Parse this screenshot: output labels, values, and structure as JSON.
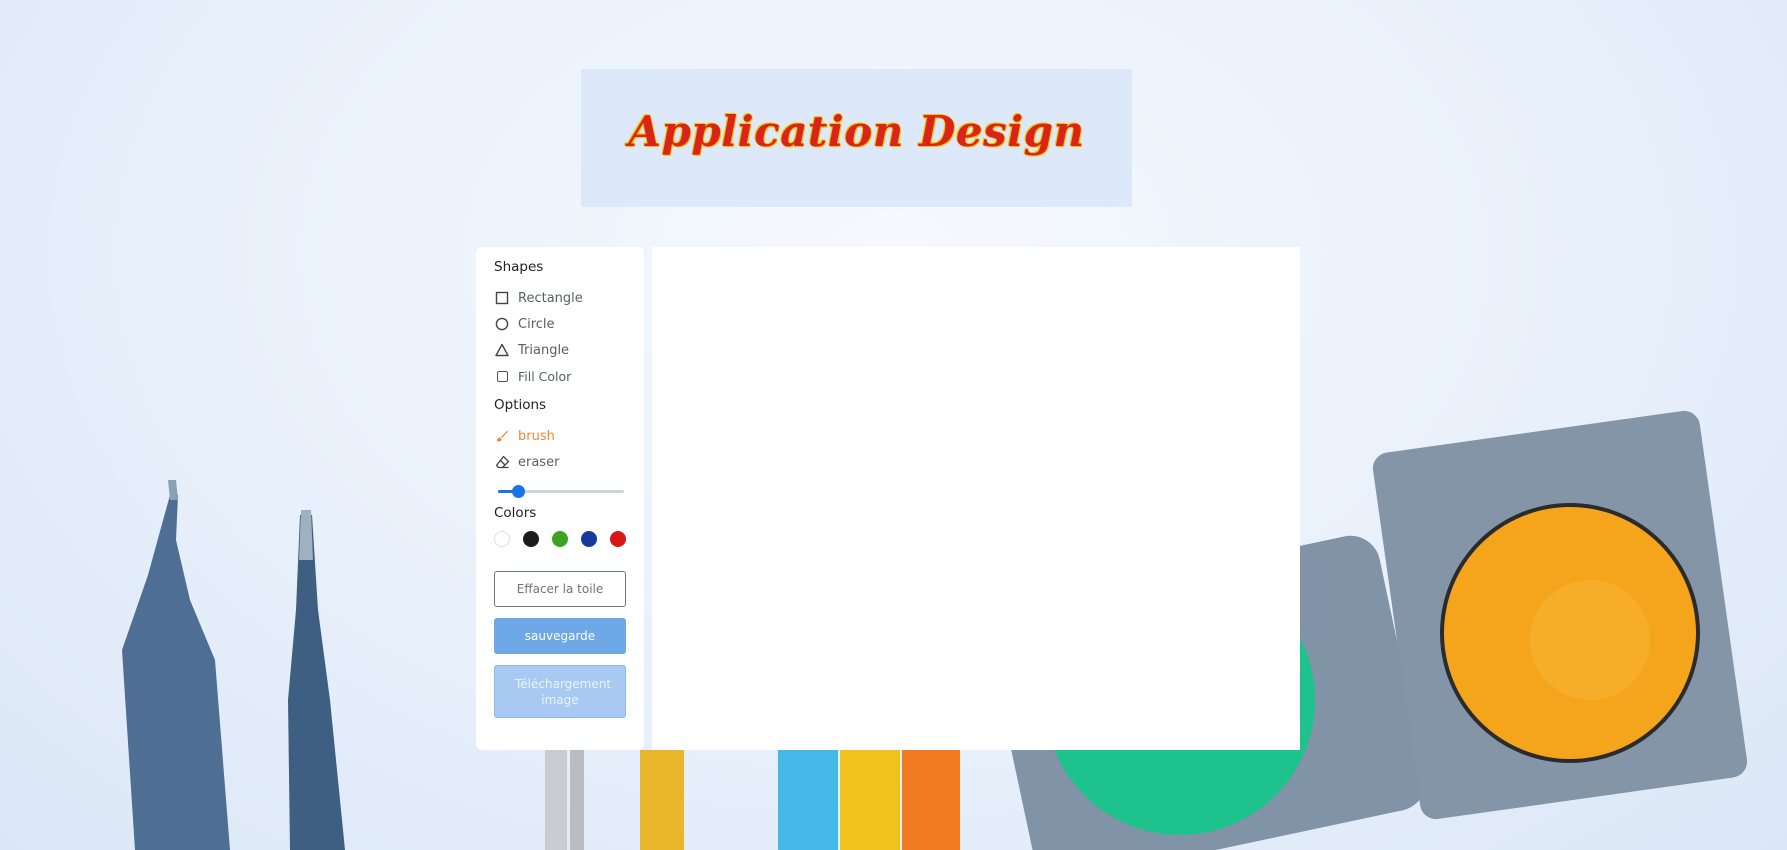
{
  "header": {
    "title": "Application Design"
  },
  "toolbar": {
    "shapes": {
      "title": "Shapes",
      "items": [
        {
          "label": "Rectangle",
          "icon": "square-outline-icon"
        },
        {
          "label": "Circle",
          "icon": "circle-outline-icon"
        },
        {
          "label": "Triangle",
          "icon": "triangle-outline-icon"
        }
      ],
      "fill_color_label": "Fill Color",
      "fill_color_checked": false
    },
    "options": {
      "title": "Options",
      "brush_label": "brush",
      "eraser_label": "eraser",
      "active": "brush",
      "brush_size_fraction": 0.16
    },
    "colors": {
      "title": "Colors",
      "swatches": [
        "#ffffff",
        "#1b1b1b",
        "#3ea321",
        "#153a9c",
        "#d61818"
      ]
    },
    "buttons": {
      "clear": "Effacer la toile",
      "save": "sauvegarde",
      "download": "Téléchargement image"
    }
  },
  "accent_colors": {
    "brush_active": "#f0873a",
    "slider": "#1a73e8",
    "title": "#d8241a"
  }
}
